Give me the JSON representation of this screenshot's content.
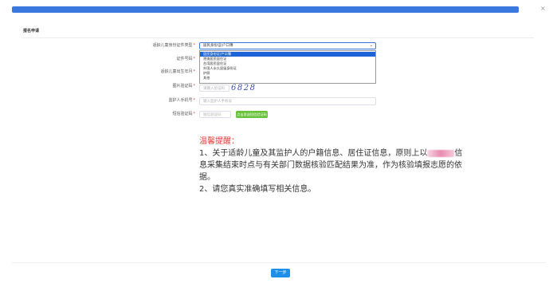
{
  "window": {
    "close_icon": "×"
  },
  "header": {
    "title": "报名申请"
  },
  "form": {
    "id_type": {
      "label": "适龄儿童身份证件类型",
      "required": "*",
      "selected": "居民身份证/户口簿",
      "options": [
        "居民身份证/户口簿",
        "港澳居民居住证",
        "台湾居民居住证",
        "外国人永久居留身份证",
        "护照",
        "其他"
      ]
    },
    "id_number": {
      "label": "证件号码",
      "required": "*"
    },
    "birth_date": {
      "label": "适龄儿童出生年月",
      "required": "*"
    },
    "image_captcha": {
      "label": "图片验证码",
      "required": "*",
      "placeholder": "请输入验证码",
      "captcha_text": "6828"
    },
    "guardian_phone": {
      "label": "监护人手机号",
      "required": "*",
      "placeholder": "输入监护人手机号"
    },
    "sms_code": {
      "label": "短信验证码",
      "required": "*",
      "placeholder": "短信验证码",
      "send_button": "点击发送短信验证码"
    }
  },
  "tips": {
    "title": "温馨提醒：",
    "line1_a": "1、关于适龄儿童及其监护人的户籍信息、居住证信息，原则上以",
    "line1_b": "信",
    "line2": "息采集结束时点与有关部门数据核验匹配结果为准，作为核验填报志愿的依",
    "line3": "据。",
    "line4": "2、请您真实准确填写相关信息。"
  },
  "footer": {
    "next_label": "下一步"
  },
  "colors": {
    "accent": "#3a78e0",
    "danger": "#e53935",
    "success": "#67c23a",
    "primary_button": "#1e8fe8"
  }
}
